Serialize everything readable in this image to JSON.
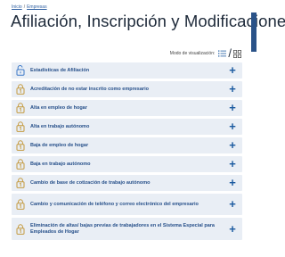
{
  "breadcrumb": {
    "home": "Inicio",
    "separator": "/",
    "current": "Empresas"
  },
  "page_title": "Afiliación, Inscripción y Modificaciones",
  "view_mode": {
    "label": "Modo de visualización:",
    "separator": "/",
    "list_icon": "list-icon",
    "grid_icon": "grid-icon"
  },
  "items": [
    {
      "label": "Estadísticas de Afiliación",
      "icon": "open-lock-icon",
      "action": "+"
    },
    {
      "label": "Acreditación de no estar inscrito como empresario",
      "icon": "certificate-lock-icon",
      "action": "+"
    },
    {
      "label": "Alta en empleo de hogar",
      "icon": "certificate-lock-icon",
      "action": "+"
    },
    {
      "label": "Alta en trabajo autónomo",
      "icon": "certificate-lock-icon",
      "action": "+"
    },
    {
      "label": "Baja de empleo de hogar",
      "icon": "certificate-lock-icon",
      "action": "+"
    },
    {
      "label": "Baja en trabajo autónomo",
      "icon": "certificate-lock-icon",
      "action": "+"
    },
    {
      "label": "Cambio de base de cotización de trabajo autónomo",
      "icon": "certificate-lock-icon",
      "action": "+"
    },
    {
      "label": "Cambio y comunicación de teléfono y correo electrónico del empresario",
      "icon": "certificate-lock-icon",
      "action": "+"
    },
    {
      "label": "Eliminación de altas/ bajas previas de trabajadores en el Sistema Especial para Empleados de Hogar",
      "icon": "certificate-lock-icon",
      "action": "+"
    }
  ],
  "colors": {
    "accent": "#1b5aa0",
    "item_bg": "#e9eef5",
    "lock_gold": "#c49a3f",
    "open_lock_blue": "#3b78c8"
  }
}
